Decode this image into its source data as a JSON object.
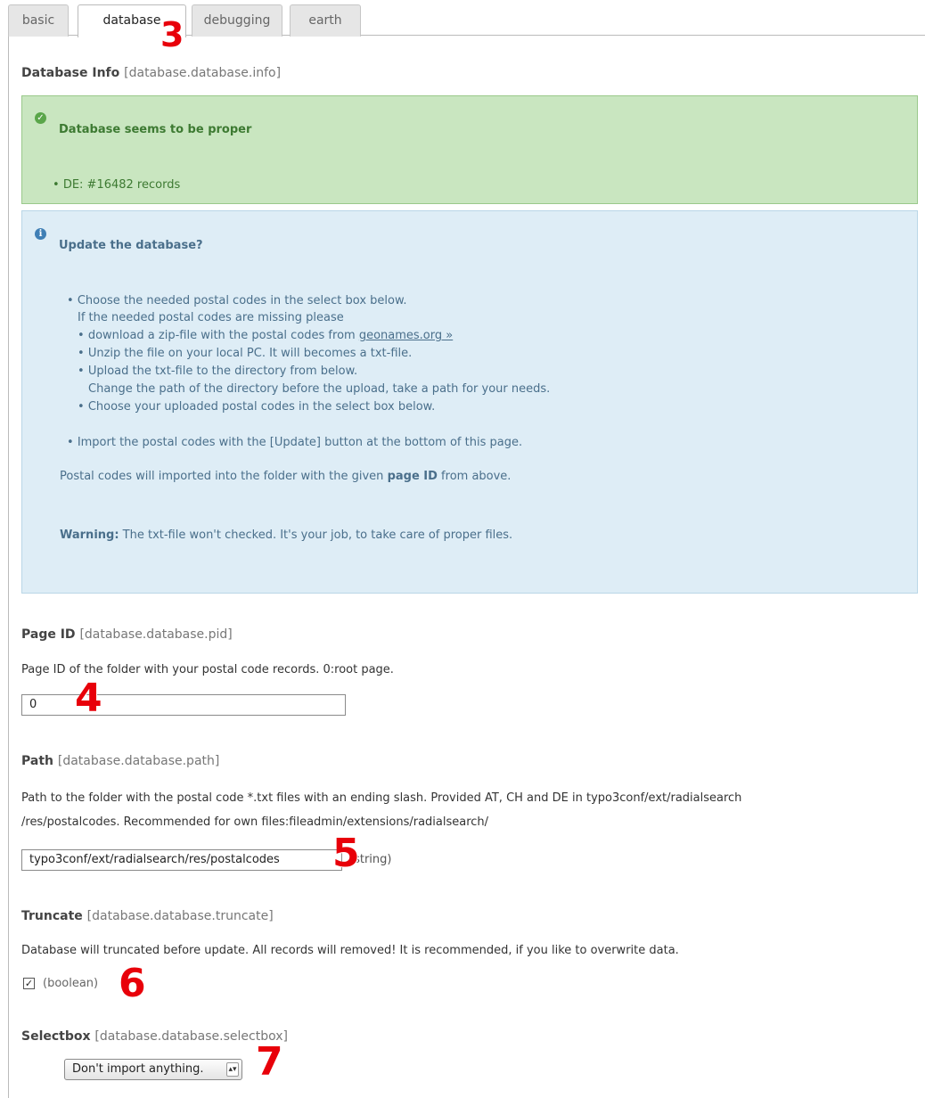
{
  "tabs": [
    {
      "label": "basic"
    },
    {
      "label": "database"
    },
    {
      "label": "debugging"
    },
    {
      "label": "earth"
    }
  ],
  "badges": {
    "tab": "3",
    "page_id": "4",
    "path": "5",
    "truncate": "6",
    "selectbox": "7"
  },
  "database_info": {
    "title": "Database Info",
    "key": "[database.database.info]",
    "ok_message": {
      "title": "Database seems to be proper",
      "item": "DE: #16482 records"
    },
    "info_message": {
      "title": "Update the database?",
      "step1_line1": "Choose the needed postal codes in the select box below.",
      "step1_line2": "If the needed postal codes are missing please",
      "sub1_prefix": "download a zip-file with the postal codes from ",
      "sub1_link": "geonames.org »",
      "sub2": "Unzip the file on your local PC. It will becomes a txt-file.",
      "sub3_line1": "Upload the txt-file to the directory from below.",
      "sub3_line2": "Change the path of the directory before the upload, take a path for your needs.",
      "sub4": "Choose your uploaded postal codes in the select box below.",
      "step2": "Import the postal codes with the [Update] button at the bottom of this page.",
      "note_prefix": "Postal codes will imported into the folder with the given ",
      "note_bold": "page ID",
      "note_suffix": " from above.",
      "warning_label": "Warning:",
      "warning_text": " The txt-file won't checked. It's your job, to take care of proper files."
    }
  },
  "page_id": {
    "title": "Page ID",
    "key": "[database.database.pid]",
    "description": "Page ID of the folder with your postal code records. 0:root page.",
    "value": "0"
  },
  "path": {
    "title": "Path",
    "key": "[database.database.path]",
    "description_line1": "Path to the folder with the postal code *.txt files with an ending slash. Provided AT, CH and DE in typo3conf/ext/radialsearch",
    "description_line2": "/res/postalcodes. Recommended for own files:fileadmin/extensions/radialsearch/",
    "value": "typo3conf/ext/radialsearch/res/postalcodes",
    "type_hint": "(string)"
  },
  "truncate": {
    "title": "Truncate",
    "key": "[database.database.truncate]",
    "description": "Database will truncated before update. All records will removed! It is recommended, if you like to overwrite data.",
    "type_hint": "(boolean)",
    "checked": true
  },
  "selectbox": {
    "title": "Selectbox",
    "key": "[database.database.selectbox]",
    "selected": "Don't import anything."
  },
  "colors": {
    "ok_bg": "#c9e6c0",
    "info_bg": "#deedf6",
    "badge": "#e8000a"
  },
  "icons": {
    "ok": "check-circle-icon",
    "info": "info-circle-icon",
    "select_arrow": "updown-arrows-icon"
  }
}
